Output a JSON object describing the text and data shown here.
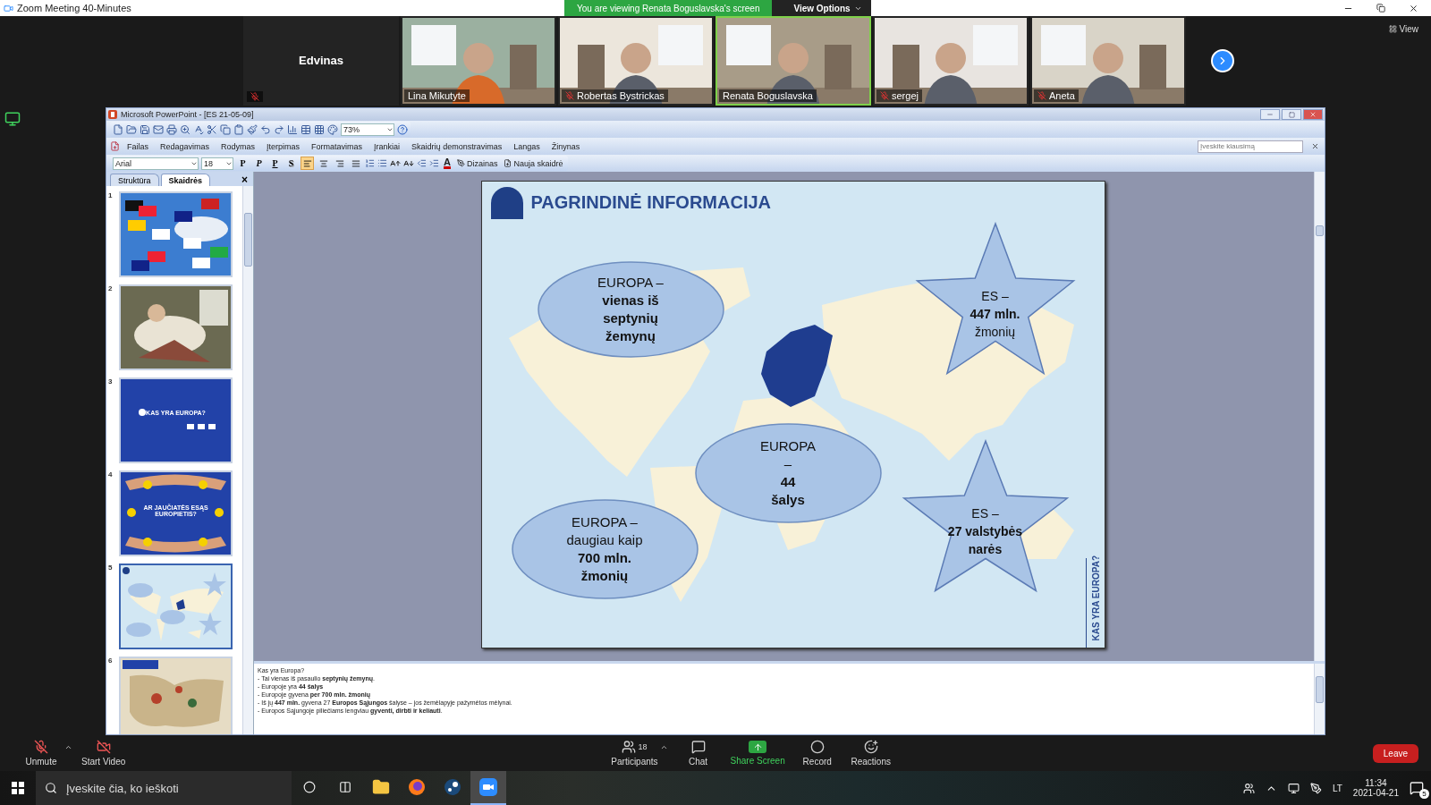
{
  "meeting_window": {
    "title": "Zoom Meeting 40-Minutes"
  },
  "share_banner": {
    "text": "You are viewing Renata Boguslavska's screen",
    "options_label": "View Options"
  },
  "participants": [
    {
      "name": "Edvinas",
      "kind": "name",
      "muted": true,
      "speaking": false
    },
    {
      "name": "Lina Mikutyte",
      "kind": "video",
      "muted": false,
      "speaking": false
    },
    {
      "name": "Robertas Bystrickas",
      "kind": "video",
      "muted": true,
      "speaking": false
    },
    {
      "name": "Renata Boguslavska",
      "kind": "video",
      "muted": false,
      "speaking": true
    },
    {
      "name": "sergej",
      "kind": "video",
      "muted": true,
      "speaking": false
    },
    {
      "name": "Aneta",
      "kind": "video",
      "muted": true,
      "speaking": false
    }
  ],
  "view_button": "View",
  "powerpoint": {
    "title": "Microsoft PowerPoint - [ES 21-05-09]",
    "zoom_value": "73%",
    "menu": [
      "Failas",
      "Redagavimas",
      "Rodymas",
      "Įterpimas",
      "Formatavimas",
      "Įrankiai",
      "Skaidrių demonstravimas",
      "Langas",
      "Žinynas"
    ],
    "help_placeholder": "Įveskite klausimą",
    "font": "Arial",
    "font_size": "18",
    "style_buttons": [
      {
        "label": "P",
        "kind": "bold"
      },
      {
        "label": "P",
        "kind": "italic"
      },
      {
        "label": "P",
        "kind": "underline"
      },
      {
        "label": "S",
        "kind": "shadow"
      }
    ],
    "alignments": [
      {
        "kind": "left",
        "selected": true
      },
      {
        "kind": "center",
        "selected": false
      },
      {
        "kind": "right",
        "selected": false
      },
      {
        "kind": "justify",
        "selected": false
      }
    ],
    "font_color_label": "A",
    "design_button": "Dizainas",
    "new_slide_button": "Nauja skaidrė",
    "pane_tabs": [
      {
        "label": "Struktūra",
        "selected": false
      },
      {
        "label": "Skaidrės",
        "selected": true
      }
    ],
    "pane_close": "×",
    "thumbnails": [
      {
        "number": "1",
        "kind": "flags",
        "selected": false
      },
      {
        "number": "2",
        "kind": "painting",
        "selected": false
      },
      {
        "number": "3",
        "kind": "title",
        "title": "KAS YRA EUROPA?",
        "selected": false
      },
      {
        "number": "4",
        "kind": "hands",
        "title": "AR JAUČIATĖS ESĄS EUROPIETIS?",
        "selected": false
      },
      {
        "number": "5",
        "kind": "map",
        "selected": true
      },
      {
        "number": "6",
        "kind": "old-map",
        "selected": false
      }
    ],
    "slide": {
      "title": "PAGRINDINĖ INFORMACIJA",
      "side_label": "KAS YRA EUROPA?",
      "shapes": [
        {
          "kind": "ellipse",
          "lines": [
            "EUROPA –",
            "**vienas iš**",
            "**septynių**",
            "**žemynų**"
          ]
        },
        {
          "kind": "star",
          "lines": [
            "ES –",
            "**447 mln.**",
            "žmonių"
          ]
        },
        {
          "kind": "ellipse",
          "lines": [
            "EUROPA",
            "–",
            "**44**",
            "**šalys**"
          ]
        },
        {
          "kind": "ellipse",
          "lines": [
            "EUROPA –",
            "daugiau kaip",
            "**700 mln.**",
            "**žmonių**"
          ]
        },
        {
          "kind": "star",
          "lines": [
            "ES –",
            "**27 valstybės**",
            "**narės**"
          ]
        }
      ]
    },
    "notes": [
      "Kas yra Europa?",
      "- Tai vienas iš pasaulio **septynių žemynų**.",
      "- Europoje yra **44 šalys**",
      "- Europoje gyvena **per 700 mln. žmonių**",
      "- Iš jų **447 mln.** gyvena 27 **Europos Sąjungos** šalyse – jos žemėlapyje pažymėtos mėlynai.",
      "- Europos Sąjungoje piliečiams lengviau **gyventi, dirbti ir keliauti**."
    ]
  },
  "zoom_controls": [
    {
      "kind": "mic-off",
      "label": "Unmute",
      "caret": true
    },
    {
      "kind": "video-off",
      "label": "Start Video",
      "caret": false
    },
    {
      "kind": "participants",
      "label": "Participants",
      "count": "18",
      "caret": true
    },
    {
      "kind": "chat",
      "label": "Chat",
      "caret": false
    },
    {
      "kind": "share",
      "label": "Share Screen",
      "caret": false
    },
    {
      "kind": "record",
      "label": "Record",
      "caret": false
    },
    {
      "kind": "reactions",
      "label": "Reactions",
      "caret": false
    }
  ],
  "leave_button": "Leave",
  "taskbar": {
    "search_placeholder": "Įveskite čia, ko ieškoti",
    "apps": [
      {
        "kind": "explorer",
        "selected": false
      },
      {
        "kind": "firefox",
        "selected": false
      },
      {
        "kind": "steam",
        "selected": false
      },
      {
        "kind": "zoom",
        "selected": true
      }
    ],
    "language": "LT",
    "time": "11:34",
    "date": "2021-04-21",
    "notification_count": "5"
  }
}
